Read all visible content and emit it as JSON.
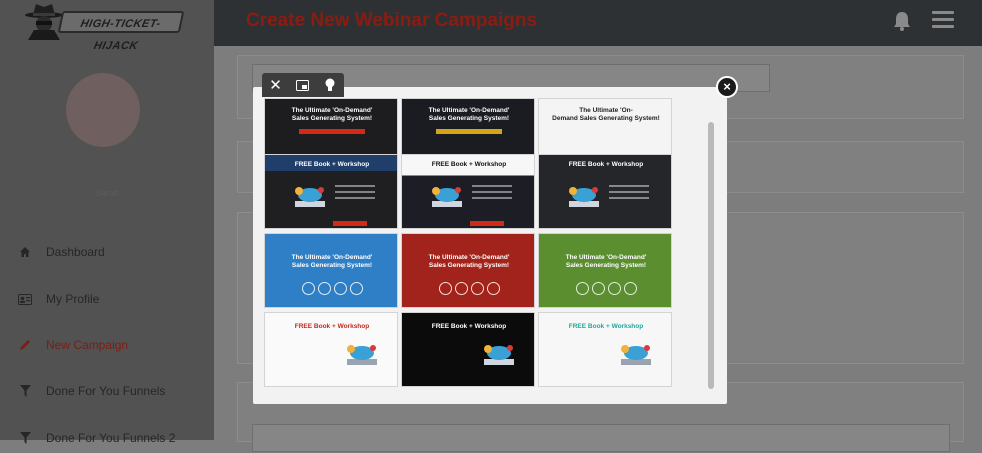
{
  "brand": {
    "logo_text": "HIGH-TICKET-HIJACK"
  },
  "sidebar": {
    "username": "Sarah",
    "items": [
      {
        "label": "Dashboard",
        "icon": "home-icon",
        "active": false
      },
      {
        "label": "My Profile",
        "icon": "id-card-icon",
        "active": false
      },
      {
        "label": "New Campaign",
        "icon": "pencil-icon",
        "active": true
      },
      {
        "label": "Done For You Funnels",
        "icon": "filter-icon",
        "active": false
      },
      {
        "label": "Done For You Funnels 2",
        "icon": "filter-icon",
        "active": false
      }
    ]
  },
  "header": {
    "title": "Create New Webinar Campaigns",
    "icons": [
      "bell-icon",
      "hamburger-menu-icon"
    ]
  },
  "modal": {
    "toolbar": [
      "close-icon",
      "window-icon",
      "lightbulb-icon"
    ],
    "close_label": "×",
    "templates": [
      {
        "style": "dark",
        "line1": "The Ultimate 'On-Demand'",
        "line2": "Sales Generating System!"
      },
      {
        "style": "dark",
        "line1": "The Ultimate 'On-Demand'",
        "line2": "Sales Generating System!"
      },
      {
        "style": "light",
        "line1": "The Ultimate 'On-",
        "line2": "Demand Sales Generating System!"
      },
      {
        "style": "navy",
        "line1": "FREE Book + Workshop",
        "line2": ""
      },
      {
        "style": "white-dark",
        "line1": "FREE Book + Workshop",
        "line2": ""
      },
      {
        "style": "charcoal",
        "line1": "FREE Book + Workshop",
        "line2": ""
      },
      {
        "style": "blue",
        "line1": "The Ultimate 'On-Demand'",
        "line2": "Sales Generating System!"
      },
      {
        "style": "red",
        "line1": "The Ultimate 'On-Demand'",
        "line2": "Sales Generating System!"
      },
      {
        "style": "green",
        "line1": "The Ultimate 'On-Demand'",
        "line2": "Sales Generating System!"
      },
      {
        "style": "white-red",
        "line1": "FREE Book + Workshop",
        "line2": ""
      },
      {
        "style": "black",
        "line1": "FREE Book + Workshop",
        "line2": ""
      },
      {
        "style": "white-teal",
        "line1": "FREE Book + Workshop",
        "line2": ""
      }
    ]
  },
  "colors": {
    "accent": "#8a1c12",
    "sidebar": "#525252",
    "topbar": "#2e3133"
  }
}
